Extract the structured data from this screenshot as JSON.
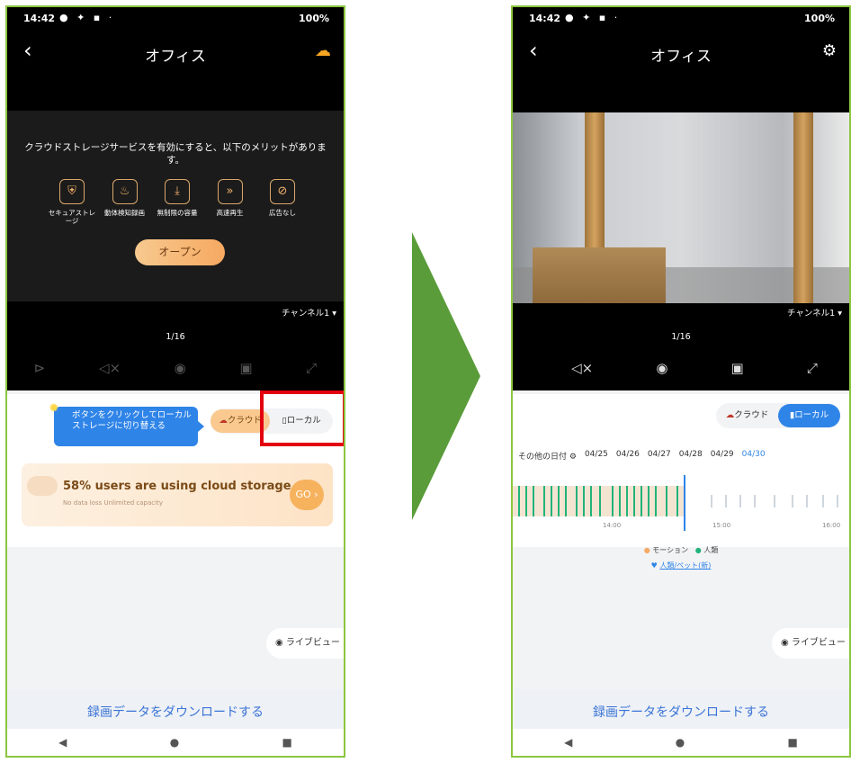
{
  "colors": {
    "frame": "#8cc63f",
    "accent": "#2f84e8",
    "arrow": "#5a9c3a",
    "highlight": "#e3000f",
    "premium": "#f6a961"
  },
  "status": {
    "time": "14:42",
    "battery": "100%"
  },
  "left": {
    "title": "オフィス",
    "promo_text": "クラウドストレージサービスを有効にすると、以下のメリットがあります。",
    "features": [
      {
        "icon": "shield-icon",
        "label": "セキュアストレージ"
      },
      {
        "icon": "alarm-icon",
        "label": "動体検知録画"
      },
      {
        "icon": "download-icon",
        "label": "無制限の容量"
      },
      {
        "icon": "fast-forward-icon",
        "label": "高速再生"
      },
      {
        "icon": "no-ads-icon",
        "label": "広告なし"
      }
    ],
    "open_button": "オープン",
    "channel": "チャンネル1",
    "pages": "1/16",
    "hint": "ボタンをクリックしてローカルストレージに切り替える",
    "toggle_cloud": "クラウド",
    "toggle_local": "ローカル",
    "card_title": "58% users are using cloud storage",
    "card_sub": "No data loss Unlimited capacity",
    "card_go": "GO",
    "live_view": "ライブビュー",
    "download": "録画データをダウンロードする"
  },
  "right": {
    "title": "オフィス",
    "channel": "チャンネル1",
    "pages": "1/16",
    "toggle_cloud": "クラウド",
    "toggle_local": "ローカル",
    "other_dates": "その他の日付",
    "dates": [
      "04/25",
      "04/26",
      "04/27",
      "04/28",
      "04/29",
      "04/30"
    ],
    "times": [
      "14:00",
      "15:00",
      "16:00"
    ],
    "legend_motion": "モーション",
    "legend_human": "人類",
    "legend_pet": "人類/ペット(新)",
    "live_view": "ライブビュー",
    "download": "録画データをダウンロードする"
  }
}
